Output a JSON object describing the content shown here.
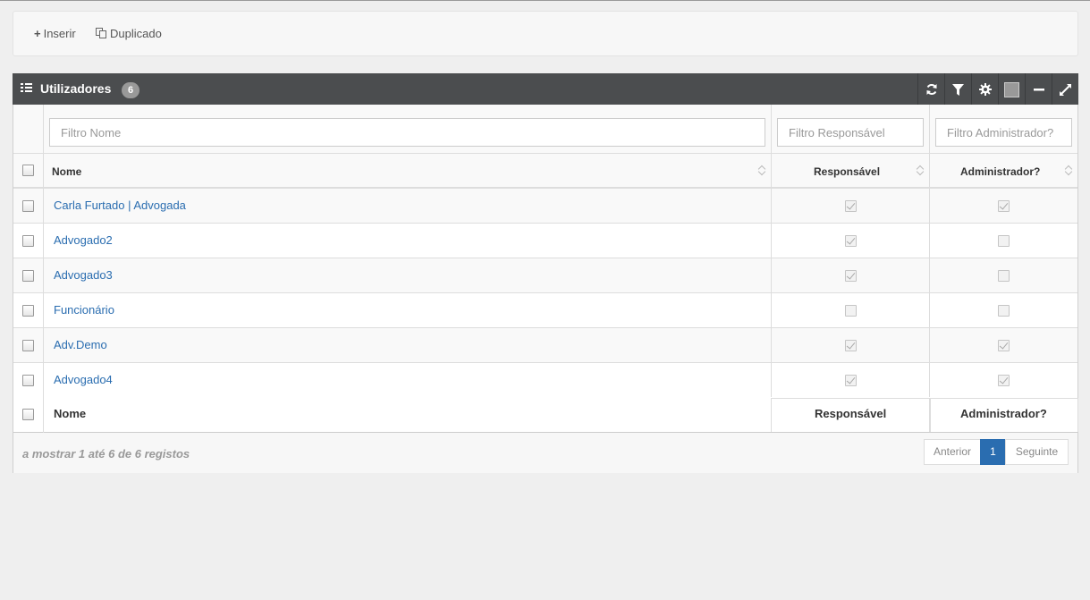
{
  "toolbar": {
    "insert_icon": "+",
    "insert_label": "Inserir",
    "duplicate_label": "Duplicado"
  },
  "panel": {
    "title": "Utilizadores",
    "count": "6",
    "tools": [
      "refresh-icon",
      "filter-icon",
      "gear-icon",
      "color-square-icon",
      "minimize-icon",
      "expand-icon"
    ]
  },
  "filters": {
    "name_placeholder": "Filtro Nome",
    "responsible_placeholder": "Filtro Responsável",
    "admin_placeholder": "Filtro Administrador?"
  },
  "columns": {
    "name": "Nome",
    "responsible": "Responsável",
    "admin": "Administrador?"
  },
  "rows": [
    {
      "name": "Carla Furtado | Advogada",
      "responsible": true,
      "admin": true
    },
    {
      "name": "Advogado2",
      "responsible": true,
      "admin": false
    },
    {
      "name": "Advogado3",
      "responsible": true,
      "admin": false
    },
    {
      "name": "Funcionário",
      "responsible": false,
      "admin": false
    },
    {
      "name": "Adv.Demo",
      "responsible": true,
      "admin": true
    },
    {
      "name": "Advogado4",
      "responsible": true,
      "admin": true
    }
  ],
  "footer": {
    "name": "Nome",
    "responsible": "Responsável",
    "admin": "Administrador?"
  },
  "pagination": {
    "info": "a mostrar 1 até 6 de 6 registos",
    "prev": "Anterior",
    "current": "1",
    "next": "Seguinte"
  },
  "colors": {
    "header_bg": "#4b4d4f",
    "link": "#2a6db0",
    "active_page": "#2a6db0"
  }
}
